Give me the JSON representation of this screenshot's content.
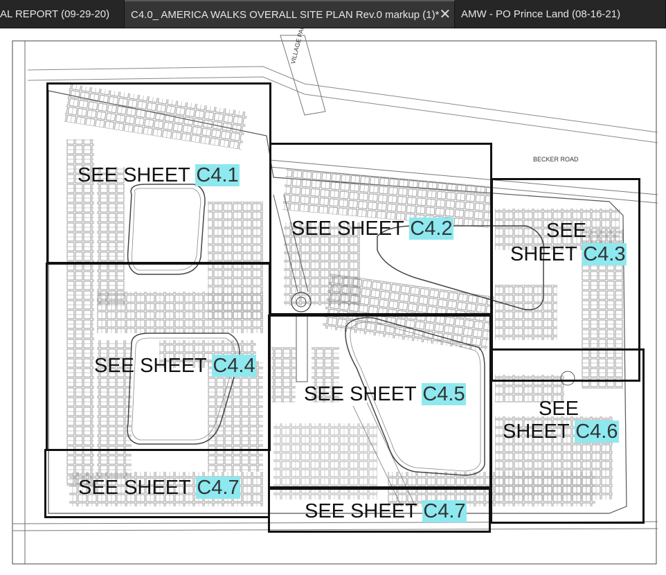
{
  "tabs": [
    {
      "label": "AL REPORT (09-29-20)"
    },
    {
      "label": "C4.0_ AMERICA WALKS OVERALL SITE PLAN  Rev.0 markup (1)*",
      "close": "✕"
    },
    {
      "label": "AMW - PO Prince Land (08-16-21)"
    }
  ],
  "drawing": {
    "village_parkway": "VILLAGE PARKWAY",
    "becker_road": "BECKER ROAD",
    "see_sheet": "SEE SHEET",
    "see": "SEE",
    "sheet": "SHEET",
    "sheets": {
      "c41": "C4.1",
      "c42": "C4.2",
      "c43": "C4.3",
      "c44": "C4.4",
      "c45": "C4.5",
      "c46": "C4.6",
      "c47a": "C4.7",
      "c47b": "C4.7"
    }
  },
  "colors": {
    "highlight": "#8de9ef",
    "tab_bg": "#262626",
    "active_tab_bg": "#353535"
  }
}
